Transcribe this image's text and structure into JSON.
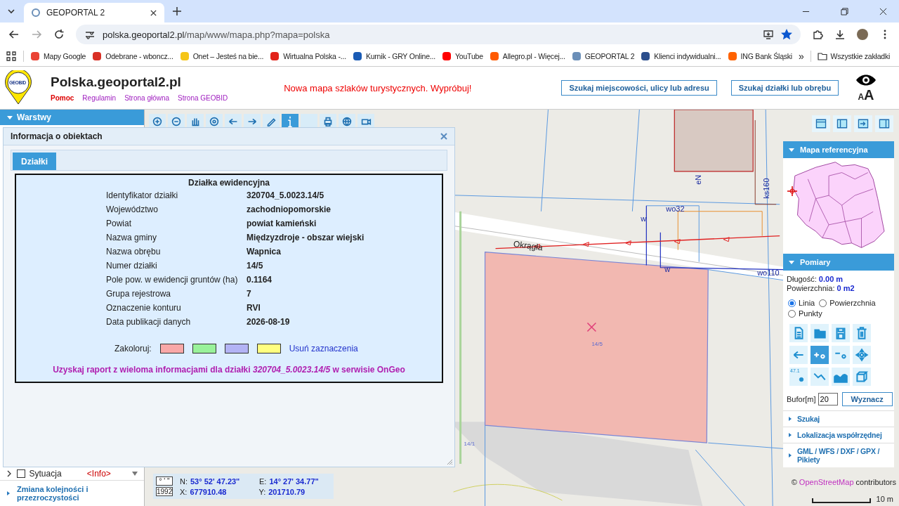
{
  "browser": {
    "tabs": [
      {
        "title": "GEOPORTAL 2",
        "selected": true
      }
    ],
    "address": {
      "host": "polska.geoportal2.pl",
      "path": "/map/www/mapa.php?mapa=polska",
      "bookmarked": true
    },
    "bookmarks": [
      {
        "label": "Mapy Google",
        "color": "#ea4335"
      },
      {
        "label": "Odebrane - wboncz...",
        "color": "#d93025"
      },
      {
        "label": "Onet – Jesteś na bie...",
        "color": "#f5c518"
      },
      {
        "label": "Wirtualna Polska -...",
        "color": "#e2231a"
      },
      {
        "label": "Kurnik - GRY Online...",
        "color": "#1a5bb5"
      },
      {
        "label": "YouTube",
        "color": "#ff0000"
      },
      {
        "label": "Allegro.pl - Więcej...",
        "color": "#ff5a00"
      },
      {
        "label": "GEOPORTAL 2",
        "color": "#6b8fb8"
      },
      {
        "label": "Klienci indywidualni...",
        "color": "#2b4e8c"
      },
      {
        "label": "ING Bank Śląski",
        "color": "#ff6200"
      }
    ],
    "overflow": "»",
    "all_bookmarks": "Wszystkie zakładki"
  },
  "header": {
    "logo": "GEOBID",
    "title": "Polska.geoportal2.pl",
    "links": [
      {
        "label": "Pomoc",
        "kind": "help"
      },
      {
        "label": "Regulamin",
        "kind": "page"
      },
      {
        "label": "Strona główna",
        "kind": "page"
      },
      {
        "label": "Strona GEOBID",
        "kind": "page"
      }
    ],
    "promo": "Nowa mapa szlaków turystycznych. Wypróbuj!",
    "search_buttons": [
      "Szukaj miejscowości, ulicy lub adresu",
      "Szukaj działki lub obrębu"
    ],
    "font_size_letters": [
      "A",
      "A"
    ]
  },
  "sidebar": {
    "title": "Warstwy",
    "expanded": true,
    "layers": [
      {
        "label": "Sytuacja",
        "checked": false,
        "info": "<Info>"
      }
    ],
    "footer_link": "Zmiana kolejności i przezroczystości"
  },
  "toolbar": [
    {
      "kind": "zoom-in",
      "selected": false
    },
    {
      "kind": "zoom-out",
      "selected": false
    },
    {
      "kind": "hand",
      "selected": false
    },
    {
      "kind": "target",
      "selected": false
    },
    {
      "kind": "back",
      "selected": false
    },
    {
      "kind": "forward",
      "selected": false
    },
    {
      "kind": "pencil",
      "selected": false
    },
    {
      "kind": "info",
      "selected": true
    },
    {
      "kind": "blank",
      "selected": false
    },
    {
      "kind": "print",
      "selected": false
    },
    {
      "kind": "globe",
      "selected": false
    },
    {
      "kind": "camera",
      "selected": false
    }
  ],
  "dialog": {
    "title": "Informacja o obiektach",
    "tabs": [
      {
        "label": "Działki",
        "selected": true
      }
    ],
    "record_title": "Działka ewidencyjna",
    "rows": [
      {
        "label": "Identyfikator działki",
        "value": "320704_5.0023.14/5"
      },
      {
        "label": "Województwo",
        "value": "zachodniopomorskie"
      },
      {
        "label": "Powiat",
        "value": "powiat kamieński"
      },
      {
        "label": "Nazwa gminy",
        "value": "Międzyzdroje - obszar wiejski"
      },
      {
        "label": "Nazwa obrębu",
        "value": "Wapnica"
      },
      {
        "label": "Numer działki",
        "value": "14/5"
      },
      {
        "label": "Pole pow. w ewidencji gruntów (ha)",
        "value": "0.1164"
      },
      {
        "label": "Grupa rejestrowa",
        "value": "7"
      },
      {
        "label": "Oznaczenie konturu",
        "value": "RVI"
      },
      {
        "label": "Data publikacji danych",
        "value": "2026-08-19"
      }
    ],
    "color_label": "Zakoloruj:",
    "swatches": [
      {
        "color": "#f9a8a8"
      },
      {
        "color": "#99f29a"
      },
      {
        "color": "#b3b3f5"
      },
      {
        "color": "#ffff80"
      }
    ],
    "clear_link": "Usuń zaznaczenia",
    "report": "Uzyskaj raport z wieloma informacjami dla działki *320704_5.0023.14/5* w serwisie OnGeo"
  },
  "view_buttons": [
    {
      "kind": "top"
    },
    {
      "kind": "left"
    },
    {
      "kind": "arrow"
    },
    {
      "kind": "right"
    }
  ],
  "panel": {
    "reference": {
      "title": "Mapa referencyjna",
      "expanded": true
    },
    "measure": {
      "title": "Pomiary",
      "expanded": true,
      "length_label": "Długość:",
      "length": "0.00 m",
      "area_label": "Powierzchnia:",
      "area": "0 m2",
      "modes": [
        {
          "label": "Linia",
          "selected": true
        },
        {
          "label": "Powierzchnia",
          "selected": false
        },
        {
          "label": "Punkty",
          "selected": false
        }
      ],
      "tools": [
        {
          "kind": "doc",
          "selected": false
        },
        {
          "kind": "folder",
          "selected": false
        },
        {
          "kind": "save",
          "selected": false
        },
        {
          "kind": "trash",
          "selected": false
        },
        {
          "kind": "back",
          "selected": false
        },
        {
          "kind": "add-point",
          "selected": true
        },
        {
          "kind": "remove-point",
          "selected": false
        },
        {
          "kind": "move",
          "selected": false
        },
        {
          "kind": "label-point",
          "text": "47.1",
          "selected": false
        },
        {
          "kind": "polyline",
          "selected": false
        },
        {
          "kind": "wave",
          "selected": false
        },
        {
          "kind": "cube",
          "selected": false
        }
      ],
      "buffer_label": "Bufor[m]",
      "buffer": "20",
      "compute": "Wyznacz"
    },
    "collapsed": [
      {
        "title": "Szukaj",
        "expanded": false
      },
      {
        "title": "Lokalizacja współrzędnej",
        "expanded": false
      },
      {
        "title": "GML / WFS / DXF / GPX / Pikiety",
        "expanded": false
      }
    ]
  },
  "map": {
    "labels": [
      {
        "text": "Okrągła",
        "kind": "street"
      },
      {
        "text": "wo32",
        "kind": "utility"
      },
      {
        "text": "wo110",
        "kind": "utility"
      },
      {
        "text": "ks160",
        "kind": "utility"
      },
      {
        "text": "eN",
        "kind": "utility"
      },
      {
        "text": "w",
        "kind": "utility"
      },
      {
        "text": "w",
        "kind": "utility"
      },
      {
        "text": "14/5",
        "kind": "parcel"
      },
      {
        "text": "14/1",
        "kind": "parcel"
      }
    ],
    "coordinates": [
      {
        "format": "° ' \"",
        "a_label": "N:",
        "a_value": "53° 52' 47.23\"",
        "b_label": "E:",
        "b_value": "14° 27' 34.77\""
      },
      {
        "format": "1992",
        "a_label": "X:",
        "a_value": "677910.48",
        "b_label": "Y:",
        "b_value": "201710.79"
      }
    ],
    "attribution_prefix": "©",
    "attribution_link": "OpenStreetMap",
    "attribution_suffix": "contributors",
    "scale": "10 m"
  }
}
